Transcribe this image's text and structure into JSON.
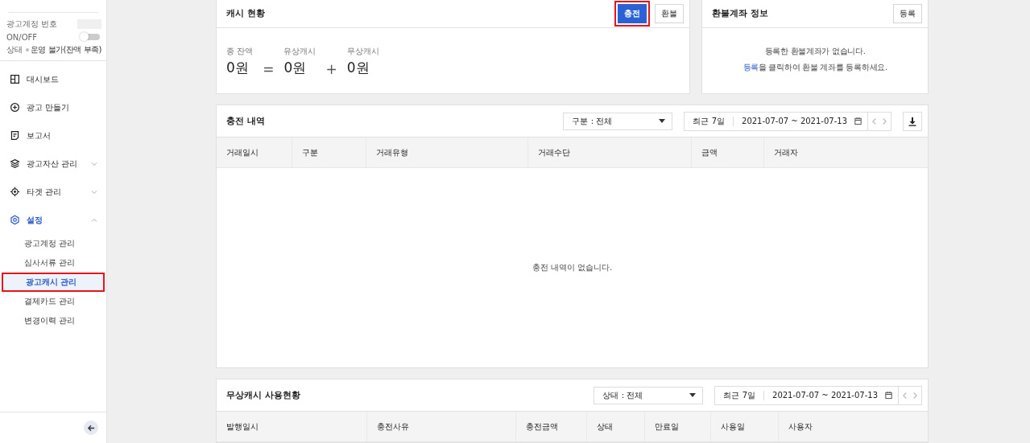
{
  "account": {
    "number_label": "광고계정 번호",
    "toggle_label": "ON/OFF",
    "on": false,
    "status_label": "상태",
    "status": "운영 불가(잔액 부족)"
  },
  "nav": [
    {
      "label": "대시보드",
      "selected": false
    },
    {
      "label": "광고 만들기",
      "selected": false
    },
    {
      "label": "보고서",
      "selected": false
    },
    {
      "label": "광고자산 관리",
      "expanded": false,
      "selected": false
    },
    {
      "label": "타겟 관리",
      "expanded": false,
      "selected": false
    },
    {
      "label": "설정",
      "expanded": true,
      "selected": true,
      "children": [
        {
          "label": "광고계정 관리",
          "selected": false,
          "highlighted": false
        },
        {
          "label": "심사서류 관리",
          "selected": false,
          "highlighted": false
        },
        {
          "label": "광고캐시 관리",
          "selected": true,
          "highlighted": true
        },
        {
          "label": "결제카드 관리",
          "selected": false,
          "highlighted": false
        },
        {
          "label": "변경이력 관리",
          "selected": false,
          "highlighted": false
        }
      ]
    }
  ],
  "cash_status": {
    "title": "캐시 현황",
    "buttons": [
      {
        "label": "충전",
        "kind": "primary",
        "highlighted": true
      },
      {
        "label": "환불",
        "kind": "default",
        "highlighted": false
      }
    ],
    "total_label": "종 잔액",
    "total": "0원",
    "equals": "=",
    "paid_label": "유상캐시",
    "paid": "0원",
    "plus": "+",
    "free_label": "무상캐시",
    "free": "0원"
  },
  "refund_account": {
    "title": "환불계좌 정보",
    "button": "등록",
    "empty_line_1": "등록한 환불계좌가 없습니다.",
    "empty_line_2_link": "등록",
    "empty_line_2": "을 클릭하여 환불 계좌를 등록하세요."
  },
  "charge_history": {
    "title": "충전 내역",
    "filter": "구분 : 전체",
    "period": "최근 7일",
    "date_range": "2021-07-07 ~ 2021-07-13",
    "columns": [
      "거래일시",
      "구분",
      "거래유형",
      "거래수단",
      "금액",
      "거래자"
    ],
    "empty": "충전 내역이 없습니다."
  },
  "free_cash_usage": {
    "title": "무상캐시 사용현황",
    "filter": "상태 : 전체",
    "period": "최근 7일",
    "date_range": "2021-07-07 ~ 2021-07-13",
    "columns": [
      "발행일시",
      "충전사유",
      "충전금액",
      "상태",
      "만료일",
      "사용일",
      "사용자"
    ]
  }
}
